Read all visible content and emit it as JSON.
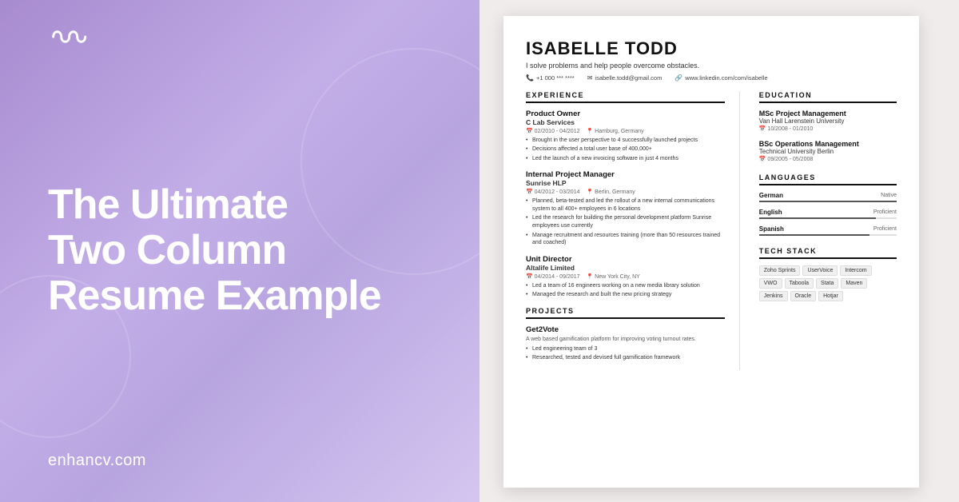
{
  "left": {
    "logo_icon": "∞",
    "headline_line1": "The Ultimate",
    "headline_line2": "Two Column",
    "headline_line3": "Resume Example",
    "website": "enhancv.com"
  },
  "resume": {
    "name": "ISABELLE TODD",
    "tagline": "I solve problems and help people overcome obstacles.",
    "contact": {
      "phone": "+1 000 *** ****",
      "email": "isabelle.todd@gmail.com",
      "linkedin": "www.linkedin.com/com/isabelle"
    },
    "experience_section": "EXPERIENCE",
    "jobs": [
      {
        "title": "Product Owner",
        "company": "C Lab Services",
        "date": "02/2010 - 04/2012",
        "location": "Hamburg, Germany",
        "bullets": [
          "Brought in the user perspective to 4 successfully launched projects",
          "Decisions affected a total user base of 400,000+",
          "Led the launch of a new invoicing software in just 4 months"
        ]
      },
      {
        "title": "Internal Project Manager",
        "company": "Sunrise HLP",
        "date": "04/2012 - 03/2014",
        "location": "Berlin, Germany",
        "bullets": [
          "Planned, beta-tested and led the rollout of a new internal communications system to all 400+ employees in 6 locations",
          "Led the research for building the personal development platform Sunrise employees use currently",
          "Manage recruitment and resources training (more than 50 resources trained and coached)"
        ]
      },
      {
        "title": "Unit Director",
        "company": "Altalife Limited",
        "date": "04/2014 - 09/2017",
        "location": "New York City, NY",
        "bullets": [
          "Led a team of 16 engineers working on a new media library solution",
          "Managed the research and built the new pricing strategy"
        ]
      }
    ],
    "projects_section": "PROJECTS",
    "projects": [
      {
        "title": "Get2Vote",
        "desc": "A web based gamification platform for improving voting turnout rates.",
        "bullets": [
          "Led engineering team of 3",
          "Researched, tested and devised full gamification framework"
        ]
      }
    ],
    "education_section": "EDUCATION",
    "education": [
      {
        "degree": "MSc Project Management",
        "school": "Van Hall Larenstein University",
        "date": "10/2008 - 01/2010"
      },
      {
        "degree": "BSc Operations Management",
        "school": "Technical University Berlin",
        "date": "09/2005 - 05/2008"
      }
    ],
    "languages_section": "LANGUAGES",
    "languages": [
      {
        "name": "German",
        "level": "Native",
        "fill": 100
      },
      {
        "name": "English",
        "level": "Proficient",
        "fill": 85
      },
      {
        "name": "Spanish",
        "level": "Proficient",
        "fill": 80
      }
    ],
    "tech_section": "TECH STACK",
    "tech": [
      "Zoho Sprints",
      "UserVoice",
      "Intercom",
      "VWO",
      "Taboola",
      "Stata",
      "Maven",
      "Jenkins",
      "Oracle",
      "Hotjar"
    ]
  }
}
